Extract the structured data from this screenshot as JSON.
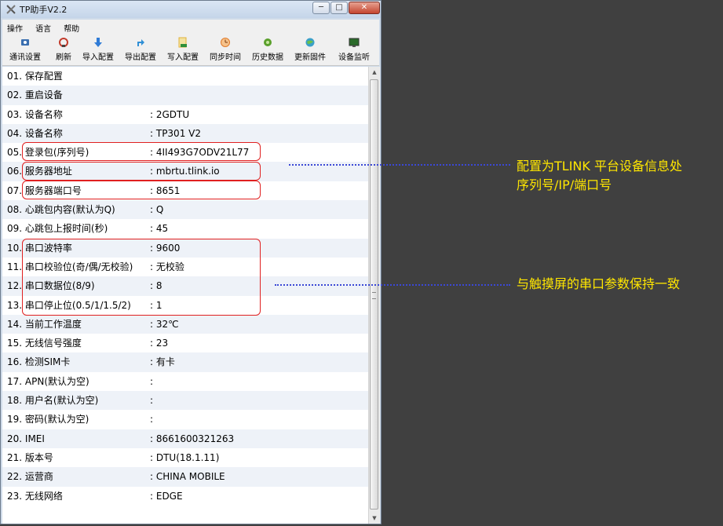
{
  "window": {
    "title": "TP助手V2.2",
    "controls": {
      "minimize": "─",
      "maximize": "□",
      "close": "✕"
    }
  },
  "menu": [
    "操作",
    "语言",
    "帮助"
  ],
  "toolbar": [
    {
      "label": "通讯设置",
      "icon": "comm-settings-icon",
      "color": "#3a6fb0"
    },
    {
      "label": "刷新",
      "icon": "refresh-icon",
      "color": "#c23b2b"
    },
    {
      "label": "导入配置",
      "icon": "import-config-icon",
      "color": "#2f7bd6"
    },
    {
      "label": "导出配置",
      "icon": "export-config-icon",
      "color": "#2f8fd6"
    },
    {
      "label": "写入配置",
      "icon": "write-config-icon",
      "color": "#e0b23a"
    },
    {
      "label": "同步时间",
      "icon": "sync-time-icon",
      "color": "#e07a2a"
    },
    {
      "label": "历史数据",
      "icon": "history-data-icon",
      "color": "#5aa02c"
    },
    {
      "label": "更新固件",
      "icon": "update-firmware-icon",
      "color": "#3aa0c8"
    },
    {
      "label": "设备监听",
      "icon": "device-monitor-icon",
      "color": "#2b6b2b"
    }
  ],
  "rows": [
    {
      "label": "01. 保存配置",
      "value": ""
    },
    {
      "label": "02. 重启设备",
      "value": ""
    },
    {
      "label": "03. 设备名称",
      "value": ": 2GDTU"
    },
    {
      "label": "04. 设备名称",
      "value": ": TP301 V2"
    },
    {
      "label": "05. 登录包(序列号)",
      "value": ": 4II493G7ODV21L77"
    },
    {
      "label": "06. 服务器地址",
      "value": ": mbrtu.tlink.io"
    },
    {
      "label": "07. 服务器端口号",
      "value": ": 8651"
    },
    {
      "label": "08. 心跳包内容(默认为Q)",
      "value": ": Q"
    },
    {
      "label": "09. 心跳包上报时间(秒)",
      "value": ": 45"
    },
    {
      "label": "10. 串口波特率",
      "value": ": 9600"
    },
    {
      "label": "11. 串口校验位(奇/偶/无校验)",
      "value": ": 无校验"
    },
    {
      "label": "12. 串口数据位(8/9)",
      "value": ": 8"
    },
    {
      "label": "13. 串口停止位(0.5/1/1.5/2)",
      "value": ": 1"
    },
    {
      "label": "14. 当前工作温度",
      "value": ": 32℃"
    },
    {
      "label": "15. 无线信号强度",
      "value": ": 23"
    },
    {
      "label": "16. 检测SIM卡",
      "value": ": 有卡"
    },
    {
      "label": "17. APN(默认为空)",
      "value": ":"
    },
    {
      "label": "18. 用户名(默认为空)",
      "value": ":"
    },
    {
      "label": "19. 密码(默认为空)",
      "value": ":"
    },
    {
      "label": "20. IMEI",
      "value": ": 8661600321263"
    },
    {
      "label": "21. 版本号",
      "value": ": DTU(18.1.11)"
    },
    {
      "label": "22. 运营商",
      "value": ": CHINA MOBILE"
    },
    {
      "label": "23. 无线网络",
      "value": ": EDGE"
    }
  ],
  "annotations": {
    "tlink": {
      "line1": "配置为TLINK 平台设备信息处",
      "line2": "序列号/IP/端口号"
    },
    "serial": {
      "line1": "与触摸屏的串口参数保持一致"
    }
  },
  "colors": {
    "highlight_box": "#e02020",
    "annotation_text": "#ffe600",
    "connector": "#3b48d6",
    "background": "#404040"
  }
}
